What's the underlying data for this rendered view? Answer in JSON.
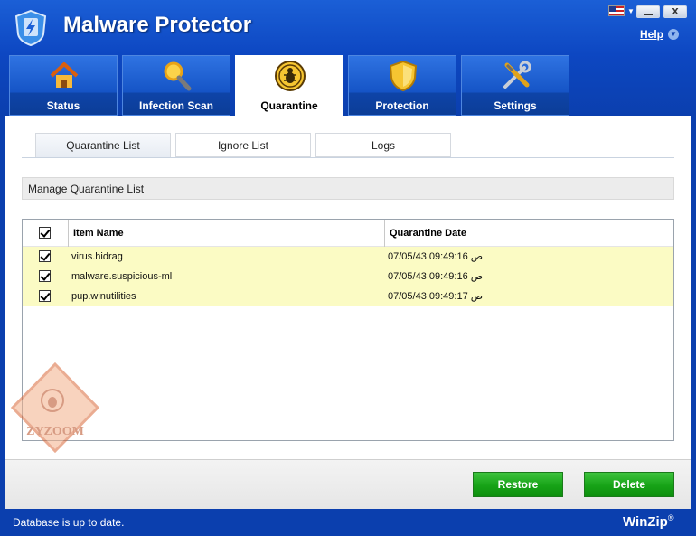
{
  "app": {
    "title": "Malware Protector",
    "help_label": "Help",
    "close_glyph": "x",
    "language_flag": "us-flag-icon",
    "brand": "WinZip",
    "brand_mark": "®"
  },
  "main_tabs": [
    {
      "label": "Status",
      "icon": "home-icon",
      "active": false
    },
    {
      "label": "Infection Scan",
      "icon": "magnifier-icon",
      "active": false
    },
    {
      "label": "Quarantine",
      "icon": "bug-icon",
      "active": true
    },
    {
      "label": "Protection",
      "icon": "shield-icon",
      "active": false
    },
    {
      "label": "Settings",
      "icon": "tools-icon",
      "active": false
    }
  ],
  "sub_tabs": [
    {
      "label": "Quarantine List",
      "active": true
    },
    {
      "label": "Ignore List",
      "active": false
    },
    {
      "label": "Logs",
      "active": false
    }
  ],
  "section": {
    "title": "Manage Quarantine List"
  },
  "table": {
    "columns": [
      "Item Name",
      "Quarantine Date"
    ],
    "header_checked": true,
    "rows": [
      {
        "checked": true,
        "name": "virus.hidrag",
        "date": "07/05/43 09:49:16 ص"
      },
      {
        "checked": true,
        "name": "malware.suspicious-ml",
        "date": "07/05/43 09:49:16 ص"
      },
      {
        "checked": true,
        "name": "pup.winutilities",
        "date": "07/05/43 09:49:17 ص"
      }
    ]
  },
  "watermark_text": "ZYZOOM",
  "buttons": {
    "restore": "Restore",
    "delete": "Delete"
  },
  "status": {
    "text": "Database is up to date."
  },
  "colors": {
    "accent": "#0d47c2",
    "button_green": "#17a317",
    "row_highlight": "#fbfbc4"
  }
}
